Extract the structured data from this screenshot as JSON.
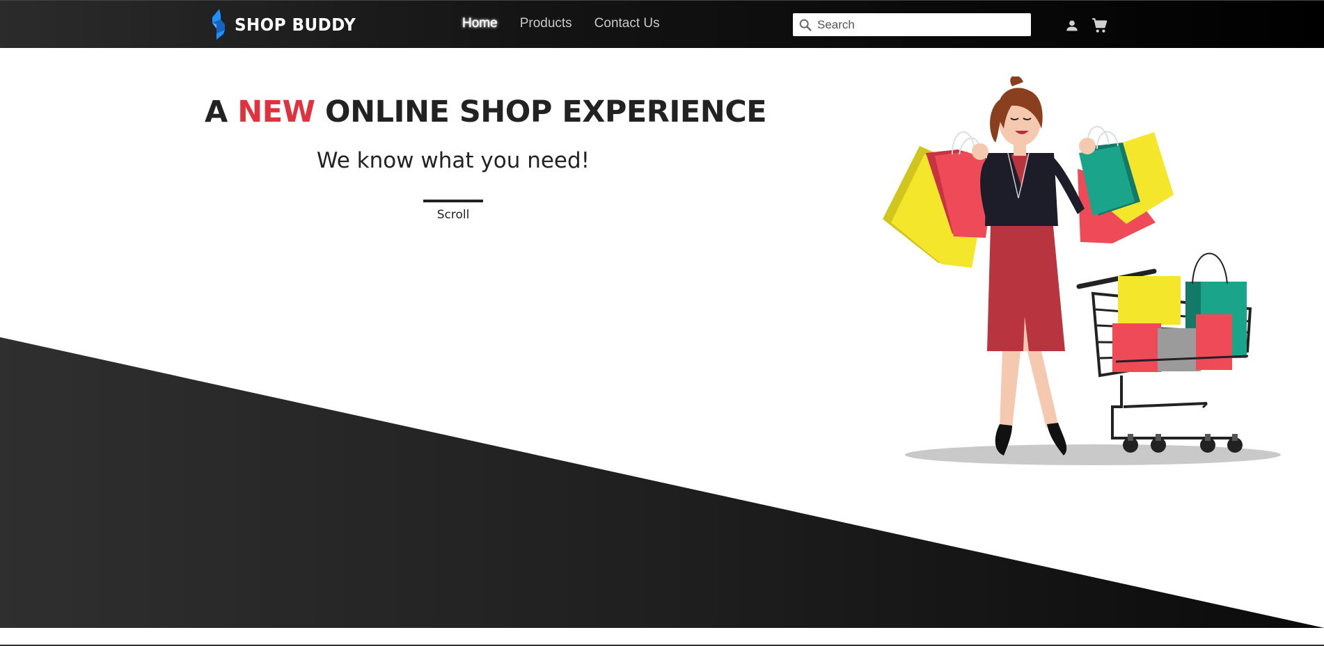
{
  "brand": {
    "name": "SHOP BUDDY",
    "logo_icon": "lightning-s-logo",
    "logo_color": "#1e90ff"
  },
  "nav": {
    "links": [
      {
        "label": "Home",
        "active": true
      },
      {
        "label": "Products",
        "active": false
      },
      {
        "label": "Contact Us",
        "active": false
      }
    ]
  },
  "search": {
    "placeholder": "Search",
    "value": "",
    "icon": "search-icon"
  },
  "header_icons": {
    "account": "user-icon",
    "cart": "cart-icon"
  },
  "hero": {
    "title_prefix": "A",
    "title_accent": "NEW",
    "title_suffix": "ONLINE SHOP EXPERIENCE",
    "subtitle": "We know what you need!",
    "scroll_label": "Scroll",
    "accent_color": "#e0323e"
  },
  "colors": {
    "dark": "#1c1c1c",
    "text": "#222222",
    "white": "#ffffff"
  }
}
